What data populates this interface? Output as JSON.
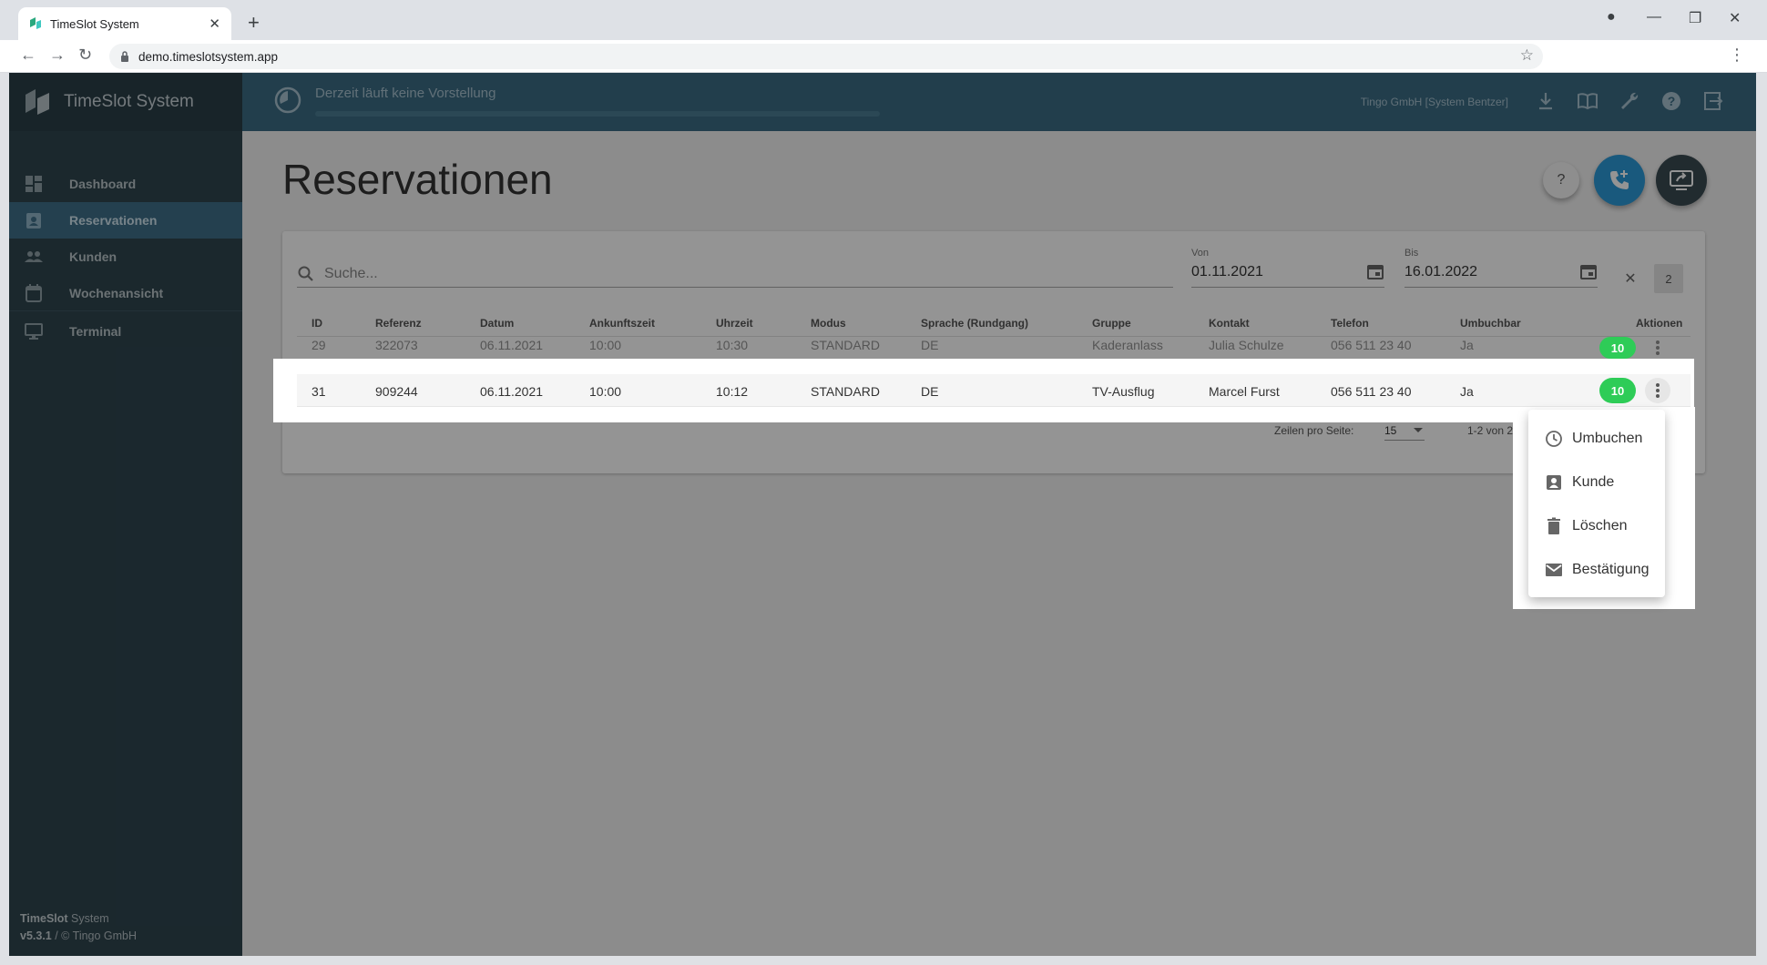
{
  "browser": {
    "tab_title": "TimeSlot System",
    "url": "demo.timeslotsystem.app"
  },
  "app": {
    "brand": "TimeSlot System",
    "nav": [
      {
        "label": "Dashboard",
        "icon": "dashboard-icon"
      },
      {
        "label": "Reservationen",
        "icon": "reservation-icon",
        "active": true
      },
      {
        "label": "Kunden",
        "icon": "people-icon"
      },
      {
        "label": "Wochenansicht",
        "icon": "calendar-icon"
      },
      {
        "label": "Terminal",
        "icon": "monitor-icon"
      }
    ],
    "footer_brand_bold": "TimeSlot",
    "footer_brand_rest": " System",
    "footer_version_bold": "v5.3.1",
    "footer_version_rest": " / © Tingo GmbH"
  },
  "topbar": {
    "status": "Derzeit läuft keine Vorstellung",
    "org": "Tingo GmbH [System Bentzer]"
  },
  "page": {
    "title": "Reservationen",
    "help_label": "?"
  },
  "filters": {
    "search_placeholder": "Suche...",
    "from_label": "Von",
    "from_value": "01.11.2021",
    "to_label": "Bis",
    "to_value": "16.01.2022",
    "count": "2"
  },
  "table": {
    "headers": [
      "ID",
      "Referenz",
      "Datum",
      "Ankunftszeit",
      "Uhrzeit",
      "Modus",
      "Sprache (Rundgang)",
      "Gruppe",
      "Kontakt",
      "Telefon",
      "Umbuchbar",
      "Aktionen"
    ],
    "rows": [
      {
        "id": "29",
        "ref": "322073",
        "date": "06.11.2021",
        "arrival": "10:00",
        "time": "10:30",
        "mode": "STANDARD",
        "lang": "DE",
        "group": "Kaderanlass",
        "contact": "Julia Schulze",
        "phone": "056 511 23 40",
        "rebook": "Ja",
        "badge": "10"
      },
      {
        "id": "31",
        "ref": "909244",
        "date": "06.11.2021",
        "arrival": "10:00",
        "time": "10:12",
        "mode": "STANDARD",
        "lang": "DE",
        "group": "TV-Ausflug",
        "contact": "Marcel Furst",
        "phone": "056 511 23 40",
        "rebook": "Ja",
        "badge": "10"
      }
    ]
  },
  "pagination": {
    "rows_label": "Zeilen pro Seite:",
    "rows_value": "15",
    "range": "1-2 von 2"
  },
  "menu": {
    "items": [
      {
        "label": "Umbuchen",
        "icon": "clock-icon"
      },
      {
        "label": "Kunde",
        "icon": "contact-icon"
      },
      {
        "label": "Löschen",
        "icon": "trash-icon"
      },
      {
        "label": "Bestätigung",
        "icon": "mail-icon"
      }
    ]
  },
  "colors": {
    "sidebar": "#2f454f",
    "topbar": "#3b6c84",
    "active_nav": "#3e6e88",
    "badge_green": "#2ecc57",
    "fab_blue": "#2b9ad8"
  }
}
